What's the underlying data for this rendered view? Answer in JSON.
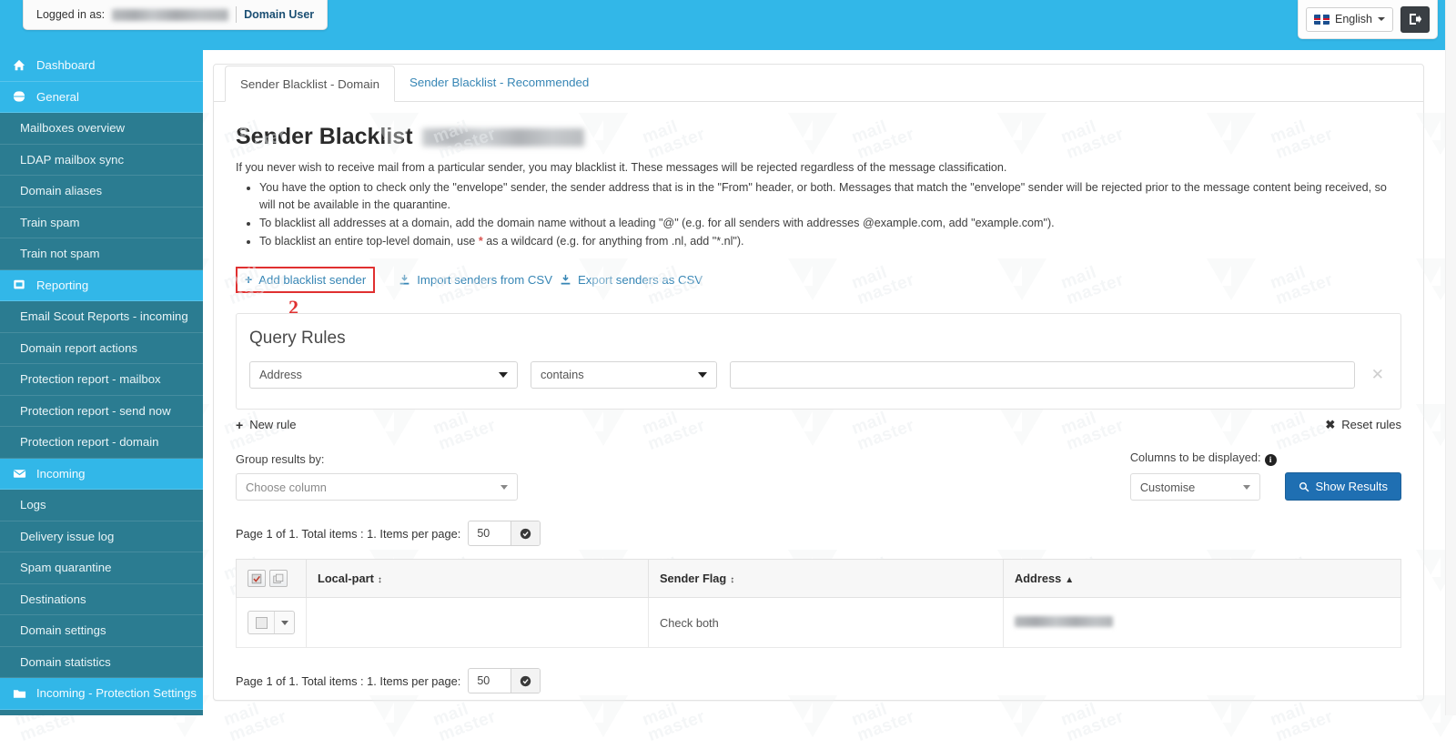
{
  "topbar": {
    "logged_in_label": "Logged in as:",
    "logged_in_user_masked": "",
    "role": "Domain User",
    "language": "English",
    "language_icon": "uk-flag-icon",
    "logout_icon": "logout-icon",
    "background_color": "#32b7e8"
  },
  "sidebar": {
    "items": [
      {
        "label": "Dashboard",
        "type": "head",
        "icon": "home-icon"
      },
      {
        "label": "General",
        "type": "head",
        "icon": "globe-icon"
      },
      {
        "label": "Mailboxes overview",
        "type": "sub"
      },
      {
        "label": "LDAP mailbox sync",
        "type": "sub"
      },
      {
        "label": "Domain aliases",
        "type": "sub"
      },
      {
        "label": "Train spam",
        "type": "sub"
      },
      {
        "label": "Train not spam",
        "type": "sub"
      },
      {
        "label": "Reporting",
        "type": "head",
        "icon": "report-icon"
      },
      {
        "label": "Email Scout Reports - incoming",
        "type": "sub"
      },
      {
        "label": "Domain report actions",
        "type": "sub"
      },
      {
        "label": "Protection report - mailbox",
        "type": "sub"
      },
      {
        "label": "Protection report - send now",
        "type": "sub"
      },
      {
        "label": "Protection report - domain",
        "type": "sub"
      },
      {
        "label": "Incoming",
        "type": "head",
        "icon": "envelope-icon"
      },
      {
        "label": "Logs",
        "type": "sub"
      },
      {
        "label": "Delivery issue log",
        "type": "sub"
      },
      {
        "label": "Spam quarantine",
        "type": "sub"
      },
      {
        "label": "Destinations",
        "type": "sub"
      },
      {
        "label": "Domain settings",
        "type": "sub"
      },
      {
        "label": "Domain statistics",
        "type": "sub"
      },
      {
        "label": "Incoming - Protection Settings",
        "type": "head",
        "icon": "folder-icon"
      }
    ],
    "head_color": "#32b7e8",
    "sub_color": "#2b7c91"
  },
  "tabs": [
    {
      "label": "Sender Blacklist - Domain",
      "active": true
    },
    {
      "label": "Sender Blacklist - Recommended",
      "active": false
    }
  ],
  "page": {
    "title": "Sender Blacklist",
    "title_domain_masked": "",
    "intro": "If you never wish to receive mail from a particular sender, you may blacklist it. These messages will be rejected regardless of the message classification.",
    "notes": [
      "You have the option to check only the \"envelope\" sender, the sender address that is in the \"From\" header, or both. Messages that match the \"envelope\" sender will be rejected prior to the message content being received, so will not be available in the quarantine.",
      "To blacklist all addresses at a domain, add the domain name without a leading \"@\" (e.g. for all senders with addresses @example.com, add \"example.com\").",
      "To blacklist an entire top-level domain, use  *  as a wildcard (e.g. for anything from .nl, add \"*.nl\")."
    ],
    "note3_prefix": "To blacklist an entire top-level domain, use",
    "note3_wildcard": "*",
    "note3_suffix": "as a wildcard (e.g. for anything from .nl, add \"*.nl\")."
  },
  "actions": {
    "add_blacklist_sender": "Add blacklist sender",
    "import_csv": "Import senders from CSV",
    "export_csv": "Export senders as CSV",
    "annotation_number": "2",
    "annotation_color": "#e03030"
  },
  "query_rules": {
    "title": "Query Rules",
    "field_value": "Address",
    "operator_value": "contains",
    "value_text": "",
    "value_placeholder": "",
    "clear_icon": "close-icon",
    "new_rule": "New rule",
    "reset_rules": "Reset rules"
  },
  "filters": {
    "group_label": "Group results by:",
    "group_value": "Choose column",
    "columns_label": "Columns to be displayed:",
    "columns_value": "Customise",
    "show_results": "Show Results",
    "primary_color": "#1f6fb2"
  },
  "pagination": {
    "text": "Page 1 of 1. Total items : 1. Items per page:",
    "items_per_page": "50",
    "go_icon": "go-icon"
  },
  "table": {
    "headers": [
      {
        "label": "",
        "sort": "",
        "name": "select-column"
      },
      {
        "label": "Local-part",
        "sort": "both",
        "name": "local-part"
      },
      {
        "label": "Sender Flag",
        "sort": "both",
        "name": "sender-flag"
      },
      {
        "label": "Address",
        "sort": "asc",
        "name": "address"
      }
    ],
    "rows": [
      {
        "local_part": "",
        "sender_flag": "Check both",
        "address_masked": ""
      }
    ]
  },
  "watermark": {
    "line1": "mail",
    "line2": "master"
  }
}
